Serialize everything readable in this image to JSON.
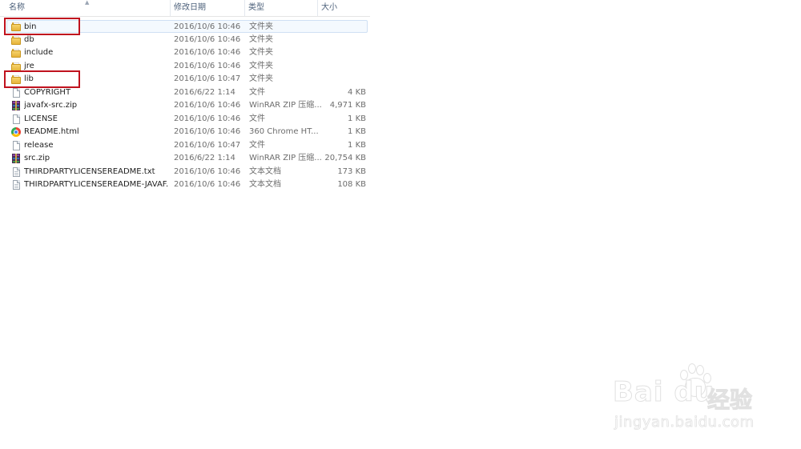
{
  "columns": {
    "name": "名称",
    "date": "修改日期",
    "type": "类型",
    "size": "大小"
  },
  "files": [
    {
      "name": "bin",
      "date": "2016/10/6 10:46",
      "type": "文件夹",
      "size": "",
      "icon": "folder-icon"
    },
    {
      "name": "db",
      "date": "2016/10/6 10:46",
      "type": "文件夹",
      "size": "",
      "icon": "folder-icon"
    },
    {
      "name": "include",
      "date": "2016/10/6 10:46",
      "type": "文件夹",
      "size": "",
      "icon": "folder-icon"
    },
    {
      "name": "jre",
      "date": "2016/10/6 10:46",
      "type": "文件夹",
      "size": "",
      "icon": "folder-icon"
    },
    {
      "name": "lib",
      "date": "2016/10/6 10:47",
      "type": "文件夹",
      "size": "",
      "icon": "folder-icon"
    },
    {
      "name": "COPYRIGHT",
      "date": "2016/6/22 1:14",
      "type": "文件",
      "size": "4 KB",
      "icon": "file-icon"
    },
    {
      "name": "javafx-src.zip",
      "date": "2016/10/6 10:46",
      "type": "WinRAR ZIP 压缩...",
      "size": "4,971 KB",
      "icon": "winrar-zip-icon"
    },
    {
      "name": "LICENSE",
      "date": "2016/10/6 10:46",
      "type": "文件",
      "size": "1 KB",
      "icon": "file-icon"
    },
    {
      "name": "README.html",
      "date": "2016/10/6 10:46",
      "type": "360 Chrome HT...",
      "size": "1 KB",
      "icon": "chrome-html-icon"
    },
    {
      "name": "release",
      "date": "2016/10/6 10:47",
      "type": "文件",
      "size": "1 KB",
      "icon": "file-icon"
    },
    {
      "name": "src.zip",
      "date": "2016/6/22 1:14",
      "type": "WinRAR ZIP 压缩...",
      "size": "20,754 KB",
      "icon": "winrar-zip-icon"
    },
    {
      "name": "THIRDPARTYLICENSEREADME.txt",
      "date": "2016/10/6 10:46",
      "type": "文本文档",
      "size": "173 KB",
      "icon": "text-document-icon"
    },
    {
      "name": "THIRDPARTYLICENSEREADME-JAVAF...",
      "date": "2016/10/6 10:46",
      "type": "文本文档",
      "size": "108 KB",
      "icon": "text-document-icon"
    }
  ],
  "selected_index": 0,
  "highlighted": [
    "bin",
    "lib"
  ],
  "highlight_color": "#c0121e",
  "selection_color": "#f4f9fe",
  "watermark": {
    "brand": "Bai  du",
    "cn": "经验",
    "url": "jingyan.baidu.com"
  }
}
